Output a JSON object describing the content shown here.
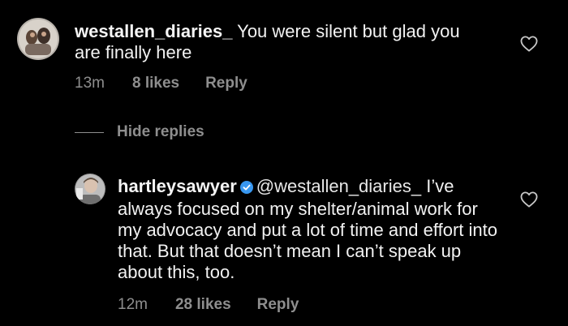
{
  "comment": {
    "username": "westallen_diaries_",
    "text": "You were silent but glad you are finally here",
    "time": "13m",
    "likes": "8 likes",
    "reply_label": "Reply",
    "avatar_icon": "avatar-photo",
    "like_icon": "heart-outline-icon"
  },
  "hide_replies": {
    "label": "Hide replies"
  },
  "reply": {
    "username": "hartleysawyer",
    "verified_icon": "verified-badge-icon",
    "mention": "@westallen_diaries_",
    "text": "I’ve always focused on my shelter/animal work for my advocacy and put a lot of time and effort into that. But that doesn’t mean I can’t speak up about this, too.",
    "time": "12m",
    "likes": "28 likes",
    "reply_label": "Reply",
    "avatar_icon": "avatar-photo",
    "like_icon": "heart-outline-icon"
  },
  "colors": {
    "background": "#000000",
    "text": "#f5f5f5",
    "secondary": "#8e8e8e",
    "verified": "#3897f0"
  }
}
